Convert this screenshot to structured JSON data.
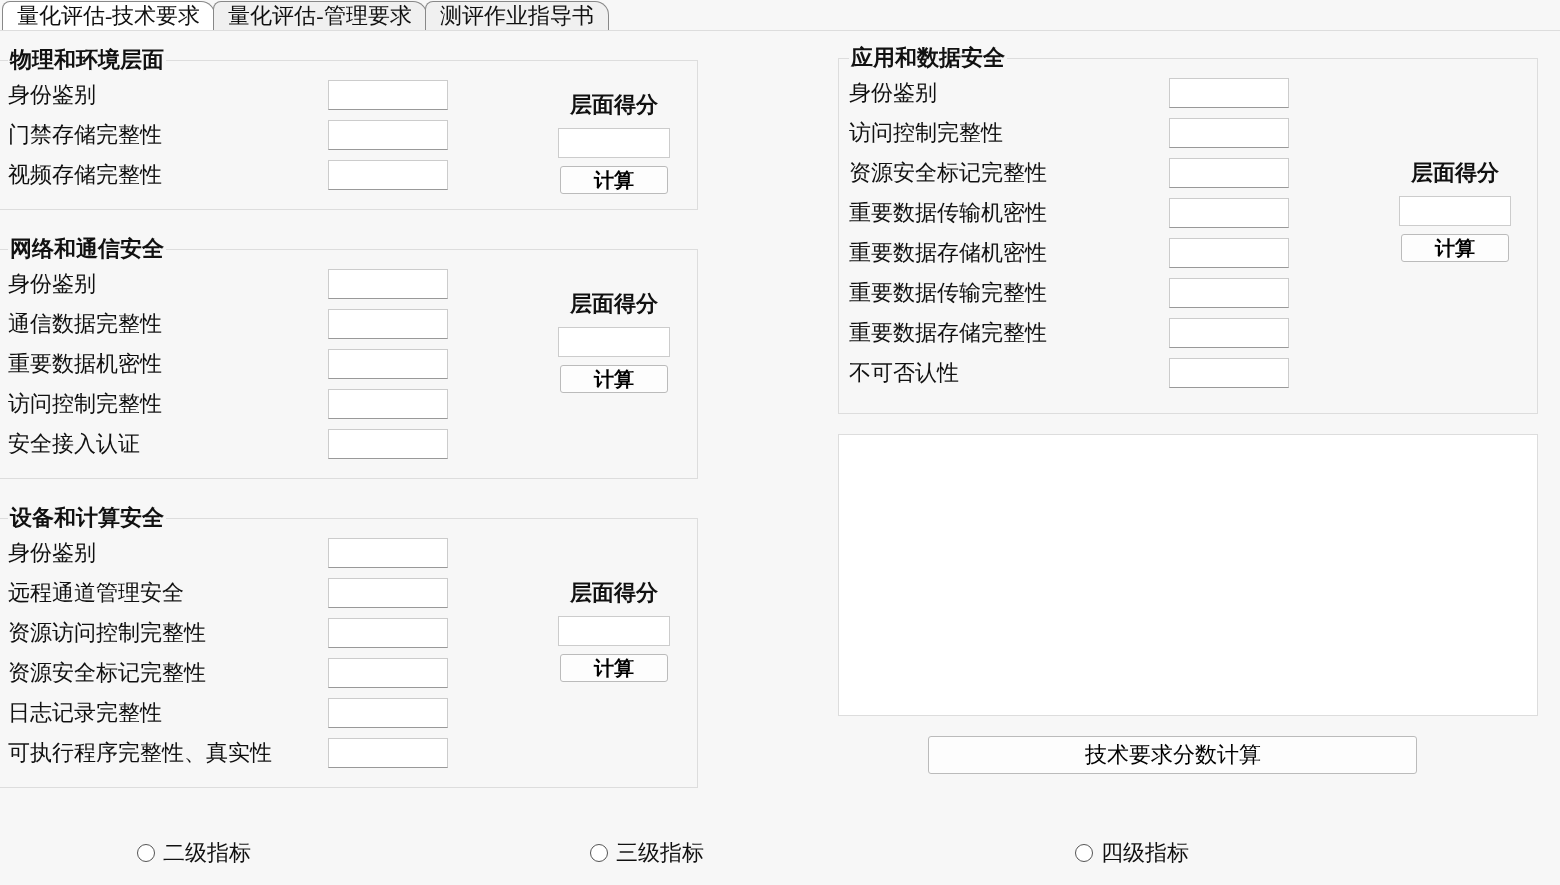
{
  "tabs": [
    {
      "label": "量化评估-技术要求",
      "selected": true
    },
    {
      "label": "量化评估-管理要求",
      "selected": false
    },
    {
      "label": "测评作业指导书",
      "selected": false
    }
  ],
  "left_groups": [
    {
      "title": "物理和环境层面",
      "items": [
        "身份鉴别",
        "门禁存储完整性",
        "视频存储完整性"
      ],
      "score_label": "层面得分",
      "calc_button": "计算"
    },
    {
      "title": "网络和通信安全",
      "items": [
        "身份鉴别",
        "通信数据完整性",
        "重要数据机密性",
        "访问控制完整性",
        "安全接入认证"
      ],
      "score_label": "层面得分",
      "calc_button": "计算"
    },
    {
      "title": "设备和计算安全",
      "items": [
        "身份鉴别",
        "远程通道管理安全",
        "资源访问控制完整性",
        "资源安全标记完整性",
        "日志记录完整性",
        "可执行程序完整性、真实性"
      ],
      "score_label": "层面得分",
      "calc_button": "计算"
    }
  ],
  "right_group": {
    "title": "应用和数据安全",
    "items": [
      "身份鉴别",
      "访问控制完整性",
      "资源安全标记完整性",
      "重要数据传输机密性",
      "重要数据存储机密性",
      "重要数据传输完整性",
      "重要数据存储完整性",
      "不可否认性"
    ],
    "score_label": "层面得分",
    "calc_button": "计算"
  },
  "total_button": "技术要求分数计算",
  "radios": [
    {
      "label": "二级指标",
      "selected": false
    },
    {
      "label": "三级指标",
      "selected": false
    },
    {
      "label": "四级指标",
      "selected": false
    }
  ]
}
